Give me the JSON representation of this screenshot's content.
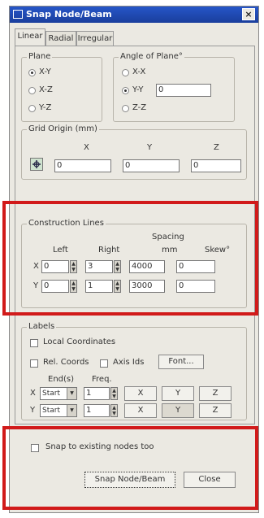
{
  "window": {
    "title": "Snap Node/Beam",
    "close_glyph": "×"
  },
  "tabs": [
    {
      "label": "Linear",
      "active": true
    },
    {
      "label": "Radial",
      "active": false
    },
    {
      "label": "Irregular",
      "active": false
    }
  ],
  "plane": {
    "label": "Plane",
    "options": [
      "X-Y",
      "X-Z",
      "Y-Z"
    ],
    "selected": "X-Y"
  },
  "angle_of_plane": {
    "label": "Angle of Plane°",
    "options": [
      "X-X",
      "Y-Y",
      "Z-Z"
    ],
    "selected": "Y-Y",
    "value": "0"
  },
  "grid_origin": {
    "label": "Grid Origin (mm)",
    "x_label": "X",
    "y_label": "Y",
    "z_label": "Z",
    "x": "0",
    "y": "0",
    "z": "0"
  },
  "construction_lines": {
    "label": "Construction Lines",
    "col_left": "Left",
    "col_right": "Right",
    "col_spacing": "Spacing",
    "col_spacing_unit": "mm",
    "col_skew": "Skew°",
    "row_x_label": "X",
    "row_y_label": "Y",
    "x": {
      "left": "0",
      "right": "3",
      "spacing": "4000",
      "skew": "0"
    },
    "y": {
      "left": "0",
      "right": "1",
      "spacing": "3000",
      "skew": "0"
    }
  },
  "labels": {
    "label": "Labels",
    "local_coords": "Local Coordinates",
    "rel_coords": "Rel. Coords",
    "axis_ids": "Axis Ids",
    "font_button": "Font...",
    "ends_label": "End(s)",
    "freq_label": "Freq.",
    "row_x_label": "X",
    "row_y_label": "Y",
    "x_ends": "Start",
    "x_freq": "1",
    "y_ends": "Start",
    "y_freq": "1",
    "axis_buttons": [
      "X",
      "Y",
      "Z"
    ]
  },
  "snap_existing": "Snap to existing nodes too",
  "buttons": {
    "snap": "Snap Node/Beam",
    "close": "Close"
  },
  "highlight_color": "#d11a1a"
}
